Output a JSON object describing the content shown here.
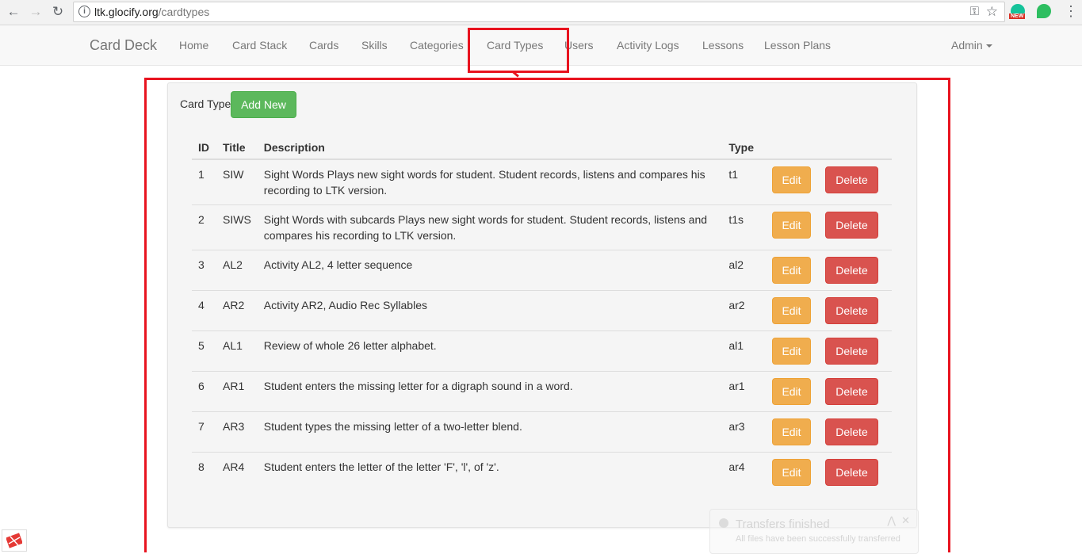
{
  "browser": {
    "url_host": "ltk.glocify.org",
    "url_path": "/cardtypes",
    "ext_badge": "NEW"
  },
  "navbar": {
    "brand": "Card Deck",
    "links": [
      "Home",
      "Card Stack",
      "Cards",
      "Skills",
      "Categories",
      "Card Types",
      "Users",
      "Activity Logs",
      "Lessons",
      "Lesson Plans"
    ],
    "active": "Card Types",
    "admin": "Admin"
  },
  "panel": {
    "title": "Card Type",
    "add_button": "Add New"
  },
  "table": {
    "headers": [
      "ID",
      "Title",
      "Description",
      "Type"
    ],
    "edit_label": "Edit",
    "delete_label": "Delete",
    "rows": [
      {
        "id": "1",
        "title": "SIW",
        "description": "Sight Words Plays new sight words for student. Student records, listens and compares his recording to LTK version.",
        "type": "t1"
      },
      {
        "id": "2",
        "title": "SIWS",
        "description": "Sight Words with subcards Plays new sight words for student. Student records, listens and compares his recording to LTK version.",
        "type": "t1s"
      },
      {
        "id": "3",
        "title": "AL2",
        "description": "Activity AL2, 4 letter sequence",
        "type": "al2"
      },
      {
        "id": "4",
        "title": "AR2",
        "description": "Activity AR2, Audio Rec Syllables",
        "type": "ar2"
      },
      {
        "id": "5",
        "title": "AL1",
        "description": "Review of whole 26 letter alphabet.",
        "type": "al1"
      },
      {
        "id": "6",
        "title": "AR1",
        "description": "Student enters the missing letter for a digraph sound in a word.",
        "type": "ar1"
      },
      {
        "id": "7",
        "title": "AR3",
        "description": "Student types the missing letter of a two-letter blend.",
        "type": "ar3"
      },
      {
        "id": "8",
        "title": "AR4",
        "description": "Student enters the letter of the letter 'F', 'l', of 'z'.",
        "type": "ar4"
      }
    ]
  },
  "toast": {
    "title": "Transfers finished",
    "message": "All files have been successfully transferred"
  },
  "colors": {
    "annotation": "#e8131f",
    "success": "#5cb85c",
    "warning": "#f0ad4e",
    "danger": "#d9534f"
  }
}
